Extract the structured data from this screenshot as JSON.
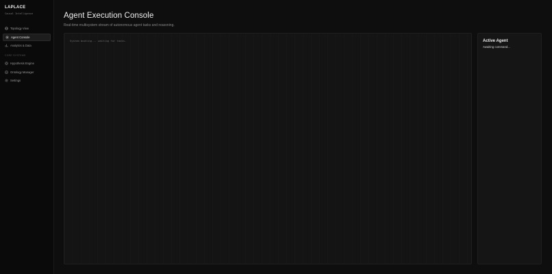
{
  "brand": {
    "title": "LAPLACE",
    "subtitle": "Causal Intelligence"
  },
  "sidebar": {
    "items": [
      {
        "label": "Topology View",
        "icon": "globe-icon"
      },
      {
        "label": "Agent Console",
        "icon": "cpu-icon",
        "active": true
      },
      {
        "label": "Analytics & Data",
        "icon": "chart-icon"
      }
    ],
    "section_label": "CORE SYSTEMS",
    "section_items": [
      {
        "label": "Hypothesis Engine",
        "icon": "target-icon"
      },
      {
        "label": "Ontology Manager",
        "icon": "database-icon"
      },
      {
        "label": "Settings",
        "icon": "gear-icon"
      }
    ]
  },
  "header": {
    "title": "Agent Execution Console",
    "subtitle": "Real-time multisystem stream of autonomous agent tasks and reasoning."
  },
  "console": {
    "lines": [
      "System booting... waiting for tasks."
    ]
  },
  "agent_panel": {
    "title": "Active Agent",
    "status": "Awaiting command..."
  },
  "colors": {
    "background": "#0e0e0e",
    "sidebar": "#0a0a0a",
    "panel": "#141414",
    "active_item": "#1d1d1d"
  }
}
